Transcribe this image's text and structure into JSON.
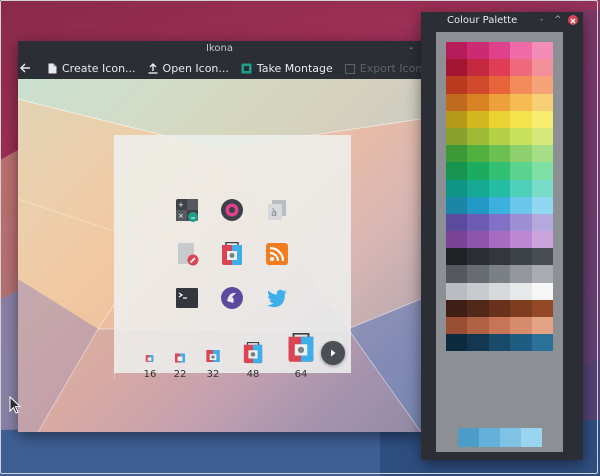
{
  "window": {
    "title": "Ikona",
    "minimize_glyph": "-",
    "toolbar": [
      {
        "label": "Create Icon...",
        "icon": "new-file-icon",
        "enabled": true
      },
      {
        "label": "Open Icon...",
        "icon": "upload-icon",
        "enabled": true
      },
      {
        "label": "Take Montage",
        "icon": "montage-icon",
        "enabled": true
      },
      {
        "label": "Export Icon...",
        "icon": "export-icon",
        "enabled": false
      }
    ]
  },
  "preview": {
    "sizes": [
      "16",
      "22",
      "32",
      "48",
      "64"
    ]
  },
  "palette_window": {
    "title": "Colour Palette",
    "controls": [
      "-",
      "^",
      "x"
    ],
    "rows": [
      [
        "#b71c5a",
        "#cc2a72",
        "#e0418c",
        "#ef6aa7",
        "#f38db8"
      ],
      [
        "#a31533",
        "#c3283f",
        "#e13d57",
        "#ee6a7c",
        "#f3909a"
      ],
      [
        "#b83a1f",
        "#d0492a",
        "#e9633b",
        "#f38b5a",
        "#f6a379"
      ],
      [
        "#bf6a1c",
        "#d88224",
        "#eea03a",
        "#f6bb55",
        "#f8ce77"
      ],
      [
        "#b59a18",
        "#d2b71e",
        "#ead232",
        "#f3e44e",
        "#f6ec6e"
      ],
      [
        "#8aa22b",
        "#9fbb35",
        "#b4d044",
        "#c8e05c",
        "#d6e879"
      ],
      [
        "#3b9a37",
        "#50b040",
        "#6cc052",
        "#8dd06d",
        "#a6dd87"
      ],
      [
        "#17944f",
        "#1dab5f",
        "#33c073",
        "#5ad38e",
        "#7fe0a6"
      ],
      [
        "#109485",
        "#16a892",
        "#24bca5",
        "#4fd0ba",
        "#78dcc9"
      ],
      [
        "#1b86a6",
        "#2199c4",
        "#3cb0de",
        "#6cc7ec",
        "#92d7f2"
      ],
      [
        "#5b4a9e",
        "#6c5cb3",
        "#8271c6",
        "#9d8fd4",
        "#b4a9df"
      ],
      [
        "#7b4396",
        "#8d55ab",
        "#a76bc2",
        "#bd88d2",
        "#cda3de"
      ],
      [
        "#1f2125",
        "#2a2d32",
        "#33373d",
        "#3d4248",
        "#474c53"
      ],
      [
        "#55595f",
        "#676b72",
        "#7b8087",
        "#93979d",
        "#a9adb2"
      ],
      [
        "#b9bcc0",
        "#c8cbce",
        "#d7d9dc",
        "#e8e9ea",
        "#f7f7f8"
      ],
      [
        "#3e1e15",
        "#522819",
        "#6a321c",
        "#7f3d20",
        "#944826"
      ],
      [
        "#9a4e34",
        "#b16144",
        "#c77556",
        "#d68c6b",
        "#e3a384"
      ],
      [
        "#0e2a3e",
        "#133751",
        "#1a4a6a",
        "#205c81",
        "#2b7099"
      ]
    ],
    "bottom_row": [
      "#4c9cc8",
      "#63b0d8",
      "#7ec2e4",
      "#9bd4ef"
    ]
  }
}
